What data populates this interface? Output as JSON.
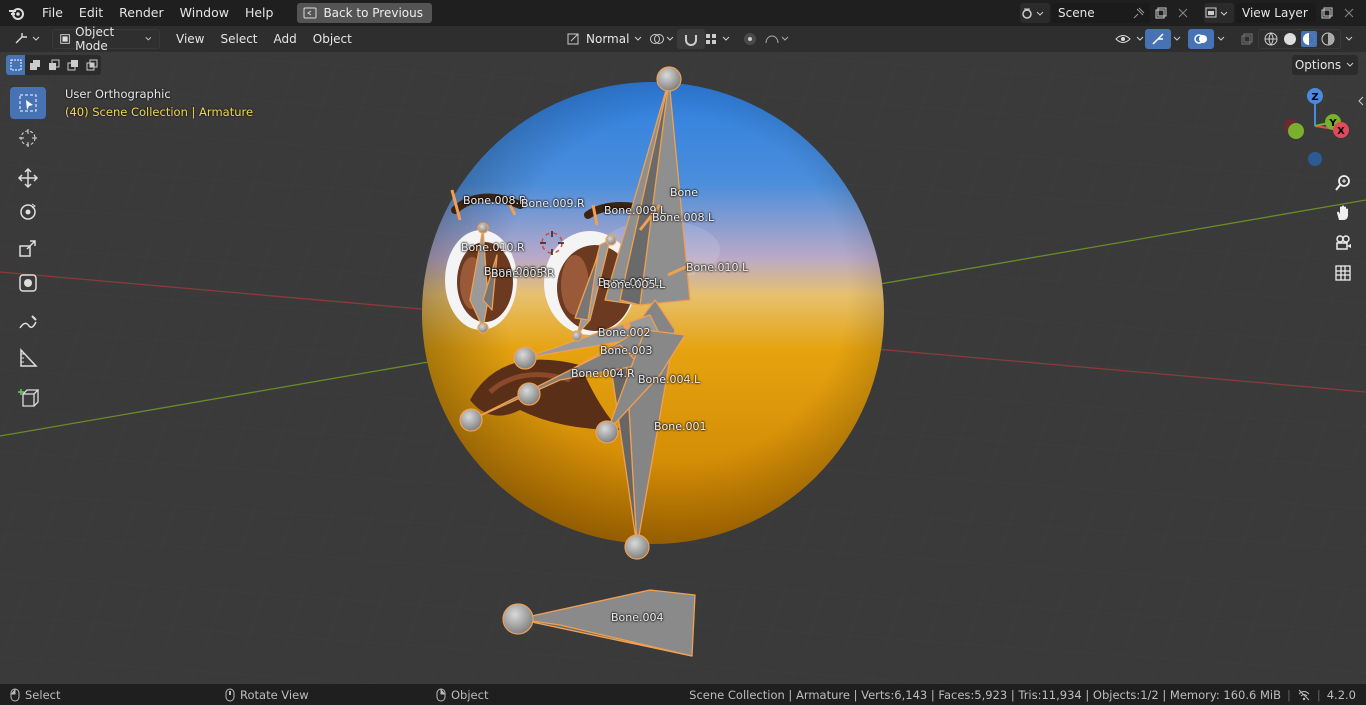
{
  "menubar": {
    "items": [
      "File",
      "Edit",
      "Render",
      "Window",
      "Help"
    ],
    "back_button": "Back to Previous",
    "scene": "Scene",
    "view_layer": "View Layer"
  },
  "viewport_header": {
    "mode": "Object Mode",
    "menus": [
      "View",
      "Select",
      "Add",
      "Object"
    ],
    "orientation": "Normal",
    "options": "Options"
  },
  "overlay": {
    "view_name": "User Orthographic",
    "collection_path": "(40) Scene Collection | Armature"
  },
  "gizmo": {
    "z": "Z",
    "y": "Y",
    "x": "X"
  },
  "bones": {
    "bone": "Bone",
    "bone001": "Bone.001",
    "bone002": "Bone.002",
    "bone003": "Bone.003",
    "bone004": "Bone.004",
    "bone004L": "Bone.004.L",
    "bone004R": "Bone.004.R",
    "bone005L": "Bone.005.L",
    "bone005LL": "Bone.005.L",
    "bone005R": "Bone.005.R",
    "bone005RR": "Bone.005.R",
    "bone008L": "Bone.008.L",
    "bone008R": "Bone.008.R",
    "bone009L": "Bone.009.L",
    "bone009R": "Bone.009.R",
    "bone010L": "Bone.010.L",
    "bone010R": "Bone.010.R"
  },
  "statusbar": {
    "select": "Select",
    "rotate": "Rotate View",
    "object": "Object",
    "stats": "Scene Collection | Armature | Verts:6,143 | Faces:5,923 | Tris:11,934 | Objects:1/2 | Memory: 160.6 MiB",
    "version": "4.2.0"
  },
  "colors": {
    "accent": "#4772b3",
    "bone_outline": "#f0a050",
    "collection_text": "#f2d64b"
  }
}
